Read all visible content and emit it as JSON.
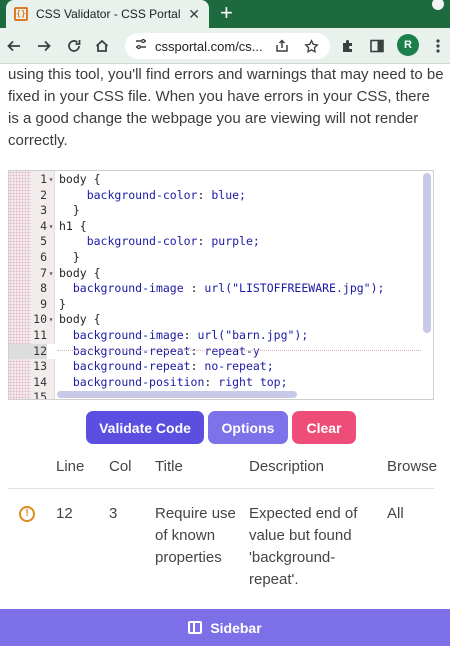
{
  "browser": {
    "tab_title": "CSS Validator - CSS Portal",
    "favicon_glyph": "{}",
    "url": "cssportal.com/cs...",
    "profile_initial": "R"
  },
  "intro_text": "using this tool, you'll find errors and warnings that may need to be fixed in your CSS file. When you have errors in your CSS, there is a good change the webpage you are viewing will not render correctly.",
  "editor": {
    "active_line": 12,
    "lines": [
      {
        "n": "1",
        "fold": true,
        "indent": "",
        "prop": "",
        "sep": "",
        "val": "",
        "text": "body {"
      },
      {
        "n": "2",
        "fold": false,
        "indent": "    ",
        "prop": "background-color",
        "sep": ": ",
        "val": "blue;",
        "text": ""
      },
      {
        "n": "3",
        "fold": false,
        "indent": "  ",
        "prop": "",
        "sep": "",
        "val": "",
        "text": "}"
      },
      {
        "n": "4",
        "fold": true,
        "indent": "",
        "prop": "",
        "sep": "",
        "val": "",
        "text": "h1 {"
      },
      {
        "n": "5",
        "fold": false,
        "indent": "    ",
        "prop": "background-color",
        "sep": ": ",
        "val": "purple;",
        "text": ""
      },
      {
        "n": "6",
        "fold": false,
        "indent": "  ",
        "prop": "",
        "sep": "",
        "val": "",
        "text": "}"
      },
      {
        "n": "7",
        "fold": true,
        "indent": "",
        "prop": "",
        "sep": "",
        "val": "",
        "text": "body {"
      },
      {
        "n": "8",
        "fold": false,
        "indent": "  ",
        "prop": "background-image",
        "sep": " : ",
        "val": "url(\"LISTOFFREEWARE.jpg\");",
        "text": ""
      },
      {
        "n": "9",
        "fold": false,
        "indent": "",
        "prop": "",
        "sep": "",
        "val": "",
        "text": "}"
      },
      {
        "n": "10",
        "fold": true,
        "indent": "",
        "prop": "",
        "sep": "",
        "val": "",
        "text": "body {"
      },
      {
        "n": "11",
        "fold": false,
        "indent": "  ",
        "prop": "background-image",
        "sep": ": ",
        "val": "url(\"barn.jpg\");",
        "text": ""
      },
      {
        "n": "12",
        "fold": false,
        "indent": "  ",
        "prop": "background-repeat",
        "sep": ": ",
        "val": "repeat-y",
        "text": ""
      },
      {
        "n": "13",
        "fold": false,
        "indent": "  ",
        "prop": "background-repeat",
        "sep": ": ",
        "val": "no-repeat;",
        "text": ""
      },
      {
        "n": "14",
        "fold": false,
        "indent": "  ",
        "prop": "background-position",
        "sep": ": ",
        "val": "right top;",
        "text": ""
      },
      {
        "n": "15",
        "fold": false,
        "indent": "",
        "prop": "",
        "sep": "",
        "val": "",
        "text": ""
      }
    ]
  },
  "buttons": {
    "validate": "Validate Code",
    "options": "Options",
    "clear": "Clear"
  },
  "results": {
    "headers": [
      "Line",
      "Col",
      "Title",
      "Description",
      "Browse"
    ],
    "rows": [
      {
        "icon": "warning-icon",
        "line": "12",
        "col": "3",
        "title": "Require use of known properties",
        "description": "Expected end of value but found 'background-repeat'.",
        "browser": "All"
      }
    ]
  },
  "footer": {
    "sidebar_label": "Sidebar"
  },
  "colors": {
    "tabstrip": "#1e6a3f",
    "validate_button": "#5b4ee0",
    "options_button": "#7d72ea",
    "clear_button": "#ee4d79",
    "sidebar_bar": "#7d6fe8"
  }
}
